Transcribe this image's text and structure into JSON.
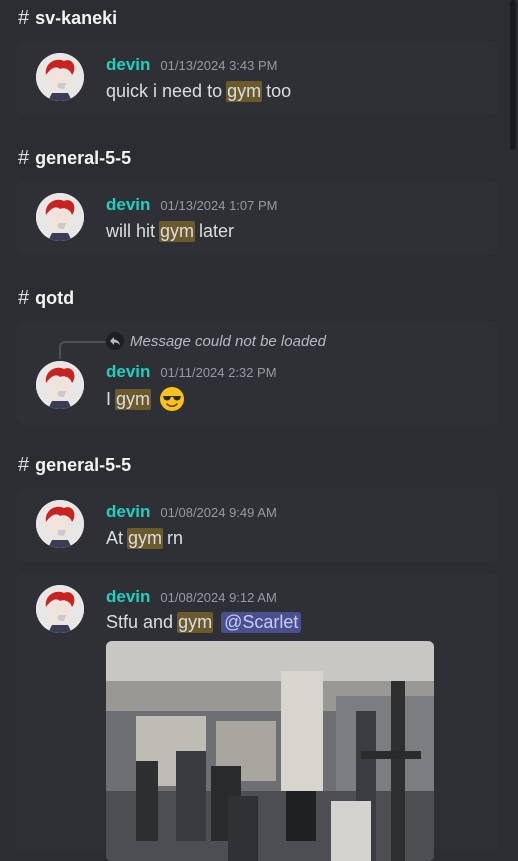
{
  "sections": [
    {
      "channel": "sv-kaneki",
      "messages": [
        {
          "username": "devin",
          "timestamp": "01/13/2024 3:43 PM",
          "before": "quick i need to",
          "highlight": "gym",
          "after": "too"
        }
      ]
    },
    {
      "channel": "general-5-5",
      "messages": [
        {
          "username": "devin",
          "timestamp": "01/13/2024 1:07 PM",
          "before": "will hit",
          "highlight": "gym",
          "after": "later"
        }
      ]
    },
    {
      "channel": "qotd",
      "messages": [
        {
          "reply": "Message could not be loaded",
          "username": "devin",
          "timestamp": "01/11/2024 2:32 PM",
          "before": "I",
          "highlight": "gym",
          "emoji": "sunglasses-emoji"
        }
      ]
    },
    {
      "channel": "general-5-5",
      "messages": [
        {
          "username": "devin",
          "timestamp": "01/08/2024 9:49 AM",
          "before": "At",
          "highlight": "gym",
          "after": "rn"
        },
        {
          "username": "devin",
          "timestamp": "01/08/2024 9:12 AM",
          "before": "Stfu and",
          "highlight": "gym",
          "mention": "@Scarlet",
          "attachment": "gym-photo"
        }
      ]
    }
  ],
  "colors": {
    "background": "#2b2d31",
    "card": "#2e3035",
    "username": "#1fcfc0",
    "highlight": "#6b5a2c",
    "mention": "#4a4f8e"
  }
}
